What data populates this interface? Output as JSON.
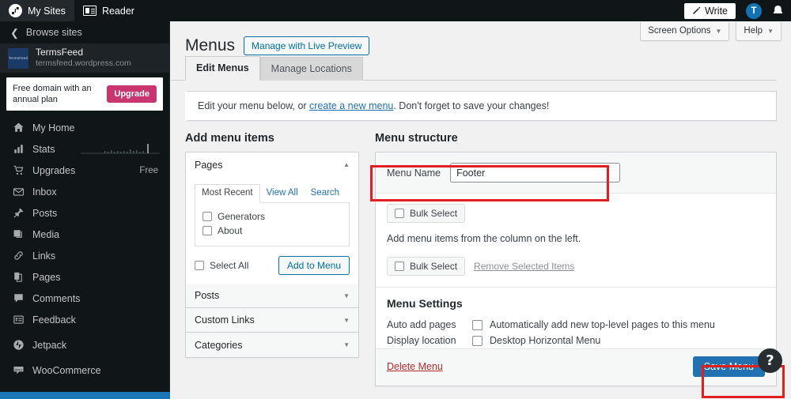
{
  "masterbar": {
    "my_sites": "My Sites",
    "reader": "Reader",
    "write": "Write",
    "avatar_initial": "T"
  },
  "sidebar": {
    "browse_sites": "Browse sites",
    "site": {
      "thumb_text": "TermsFeed",
      "name": "TermsFeed",
      "url": "termsfeed.wordpress.com"
    },
    "banner": {
      "text": "Free domain with an annual plan",
      "button": "Upgrade"
    },
    "items": [
      {
        "label": "My Home",
        "icon": "home-icon",
        "badge": ""
      },
      {
        "label": "Stats",
        "icon": "stats-icon",
        "badge": ""
      },
      {
        "label": "Upgrades",
        "icon": "cart-icon",
        "badge": "Free"
      },
      {
        "label": "Inbox",
        "icon": "envelope-icon",
        "badge": ""
      },
      {
        "label": "Posts",
        "icon": "pin-icon",
        "badge": ""
      },
      {
        "label": "Media",
        "icon": "media-icon",
        "badge": ""
      },
      {
        "label": "Links",
        "icon": "link-icon",
        "badge": ""
      },
      {
        "label": "Pages",
        "icon": "pages-icon",
        "badge": ""
      },
      {
        "label": "Comments",
        "icon": "comment-icon",
        "badge": ""
      },
      {
        "label": "Feedback",
        "icon": "feedback-icon",
        "badge": ""
      },
      {
        "label": "Jetpack",
        "icon": "jetpack-icon",
        "badge": ""
      },
      {
        "label": "WooCommerce",
        "icon": "woocommerce-icon",
        "badge": ""
      }
    ]
  },
  "header": {
    "screen_options": "Screen Options",
    "help": "Help",
    "title": "Menus",
    "live_preview": "Manage with Live Preview"
  },
  "tabs": [
    {
      "label": "Edit Menus",
      "active": true
    },
    {
      "label": "Manage Locations",
      "active": false
    }
  ],
  "notice": {
    "before": "Edit your menu below, or ",
    "link": "create a new menu",
    "after": ". Don't forget to save your changes!"
  },
  "add_menu_items": {
    "heading": "Add menu items",
    "pages_panel": {
      "title": "Pages",
      "tabs": [
        "Most Recent",
        "View All",
        "Search"
      ],
      "active_tab": "Most Recent",
      "items": [
        "Generators",
        "About"
      ],
      "select_all": "Select All",
      "add_button": "Add to Menu"
    },
    "collapsed": [
      "Posts",
      "Custom Links",
      "Categories"
    ]
  },
  "menu_structure": {
    "heading": "Menu structure",
    "menu_name_label": "Menu Name",
    "menu_name_value": "Footer",
    "bulk_select_top": "Bulk Select",
    "hint": "Add menu items from the column on the left.",
    "bulk_select_bottom": "Bulk Select",
    "remove_selected": "Remove Selected Items",
    "settings": {
      "title": "Menu Settings",
      "auto_add_label": "Auto add pages",
      "auto_add_option": "Automatically add new top-level pages to this menu",
      "display_location_label": "Display location",
      "display_location_option": "Desktop Horizontal Menu"
    },
    "delete_menu": "Delete Menu",
    "save_menu": "Save Menu"
  },
  "help_fab": "?",
  "colors": {
    "masterbar": "#101517",
    "sidebar": "#101517",
    "accent_blue": "#2271b1",
    "upgrade_pink": "#c9356e",
    "highlight_red": "#e02020",
    "delete_red": "#b32d2e",
    "sidebar_bottom": "#1b76b8"
  }
}
